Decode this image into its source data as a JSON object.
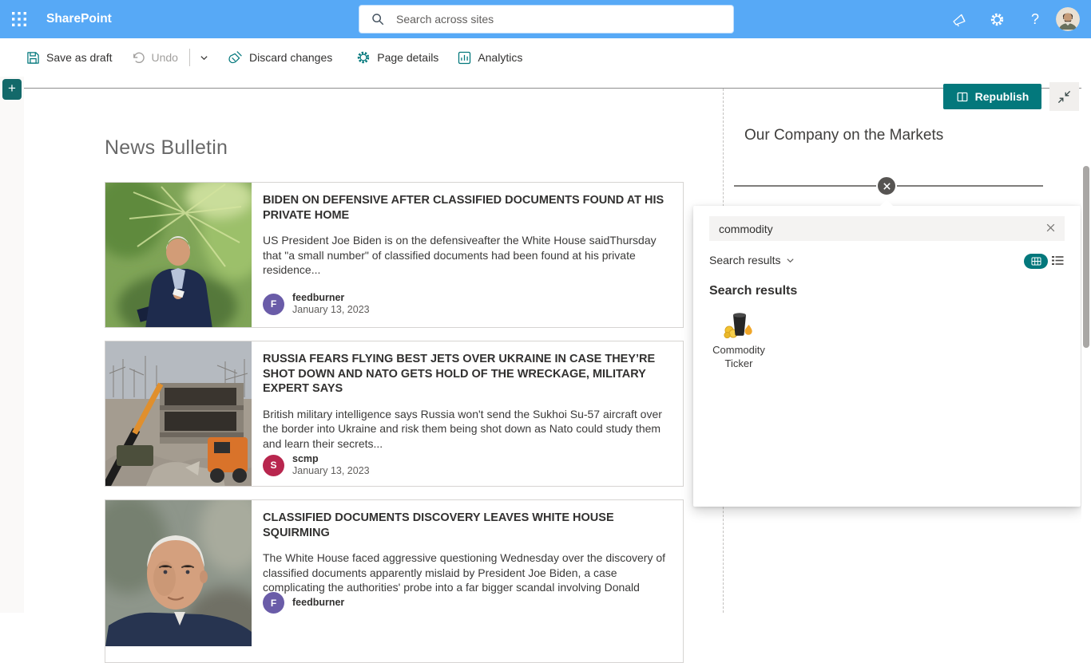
{
  "suite_bar": {
    "app_name": "SharePoint",
    "search": {
      "placeholder": "Search across sites"
    }
  },
  "command_bar": {
    "save_as_draft": "Save as draft",
    "undo": "Undo",
    "discard_changes": "Discard changes",
    "page_details": "Page details",
    "analytics": "Analytics",
    "republish": "Republish"
  },
  "page": {
    "news": {
      "title": "News Bulletin",
      "items": [
        {
          "title": "BIDEN ON DEFENSIVE AFTER CLASSIFIED DOCUMENTS FOUND AT HIS PRIVATE HOME",
          "excerpt": "US President Joe Biden is on the defensiveafter the White House saidThursday that \"a small number\" of classified documents had been found at his private residence...",
          "author": "feedburner",
          "avatar_letter": "F",
          "date": "January 13, 2023",
          "image_alt": "Joe Biden in a navy suit seated in front of green palm foliage"
        },
        {
          "title": "RUSSIA FEARS FLYING BEST JETS OVER UKRAINE IN CASE THEY’RE SHOT DOWN AND NATO GETS HOLD OF THE WRECKAGE, MILITARY EXPERT SAYS",
          "excerpt": "British military intelligence says Russia won't send the Sukhoi Su-57 aircraft over the border into Ukraine and risk them being shot down as Nato could study them and learn their secrets...",
          "author": "scmp",
          "avatar_letter": "S",
          "date": "January 13, 2023",
          "image_alt": "Destroyed building rubble with a crane and orange excavator"
        },
        {
          "title": "CLASSIFIED DOCUMENTS DISCOVERY LEAVES WHITE HOUSE SQUIRMING",
          "excerpt": "The White House faced aggressive questioning Wednesday over the discovery of classified documents apparently mislaid by President Joe Biden, a case complicating the authorities' probe into a far bigger scandal involving Donald",
          "author": "feedburner",
          "avatar_letter": "F",
          "image_alt": "Close-up of Joe Biden's face against a blurred background"
        }
      ]
    },
    "markets": {
      "title": "Our Company on the Markets"
    }
  },
  "toolbox": {
    "search_value": "commodity",
    "scope_label": "Search results",
    "results_heading": "Search results",
    "results": [
      {
        "label": "Commodity Ticker"
      }
    ]
  },
  "icons": {
    "suite_bar": [
      "app-launcher",
      "search",
      "megaphone",
      "settings-gear",
      "help",
      "account-avatar"
    ],
    "command_bar": [
      "save",
      "undo",
      "chevron-down",
      "broom-discard",
      "gear",
      "analytics-chart",
      "open-book",
      "collapse-arrows"
    ],
    "left_rail": [
      "add-section",
      "edit-page",
      "move",
      "copy",
      "delete-trash"
    ],
    "toolbox": [
      "clear-x",
      "chevron-down",
      "grid-view",
      "list-view",
      "commodity-barrel"
    ]
  },
  "colors": {
    "suite_bar_blue": "#57a9f6",
    "accent_teal": "#03787c",
    "avatar_feedburner": "#6a5ca8",
    "avatar_scmp": "#b8264e",
    "close_circle": "#565452"
  }
}
